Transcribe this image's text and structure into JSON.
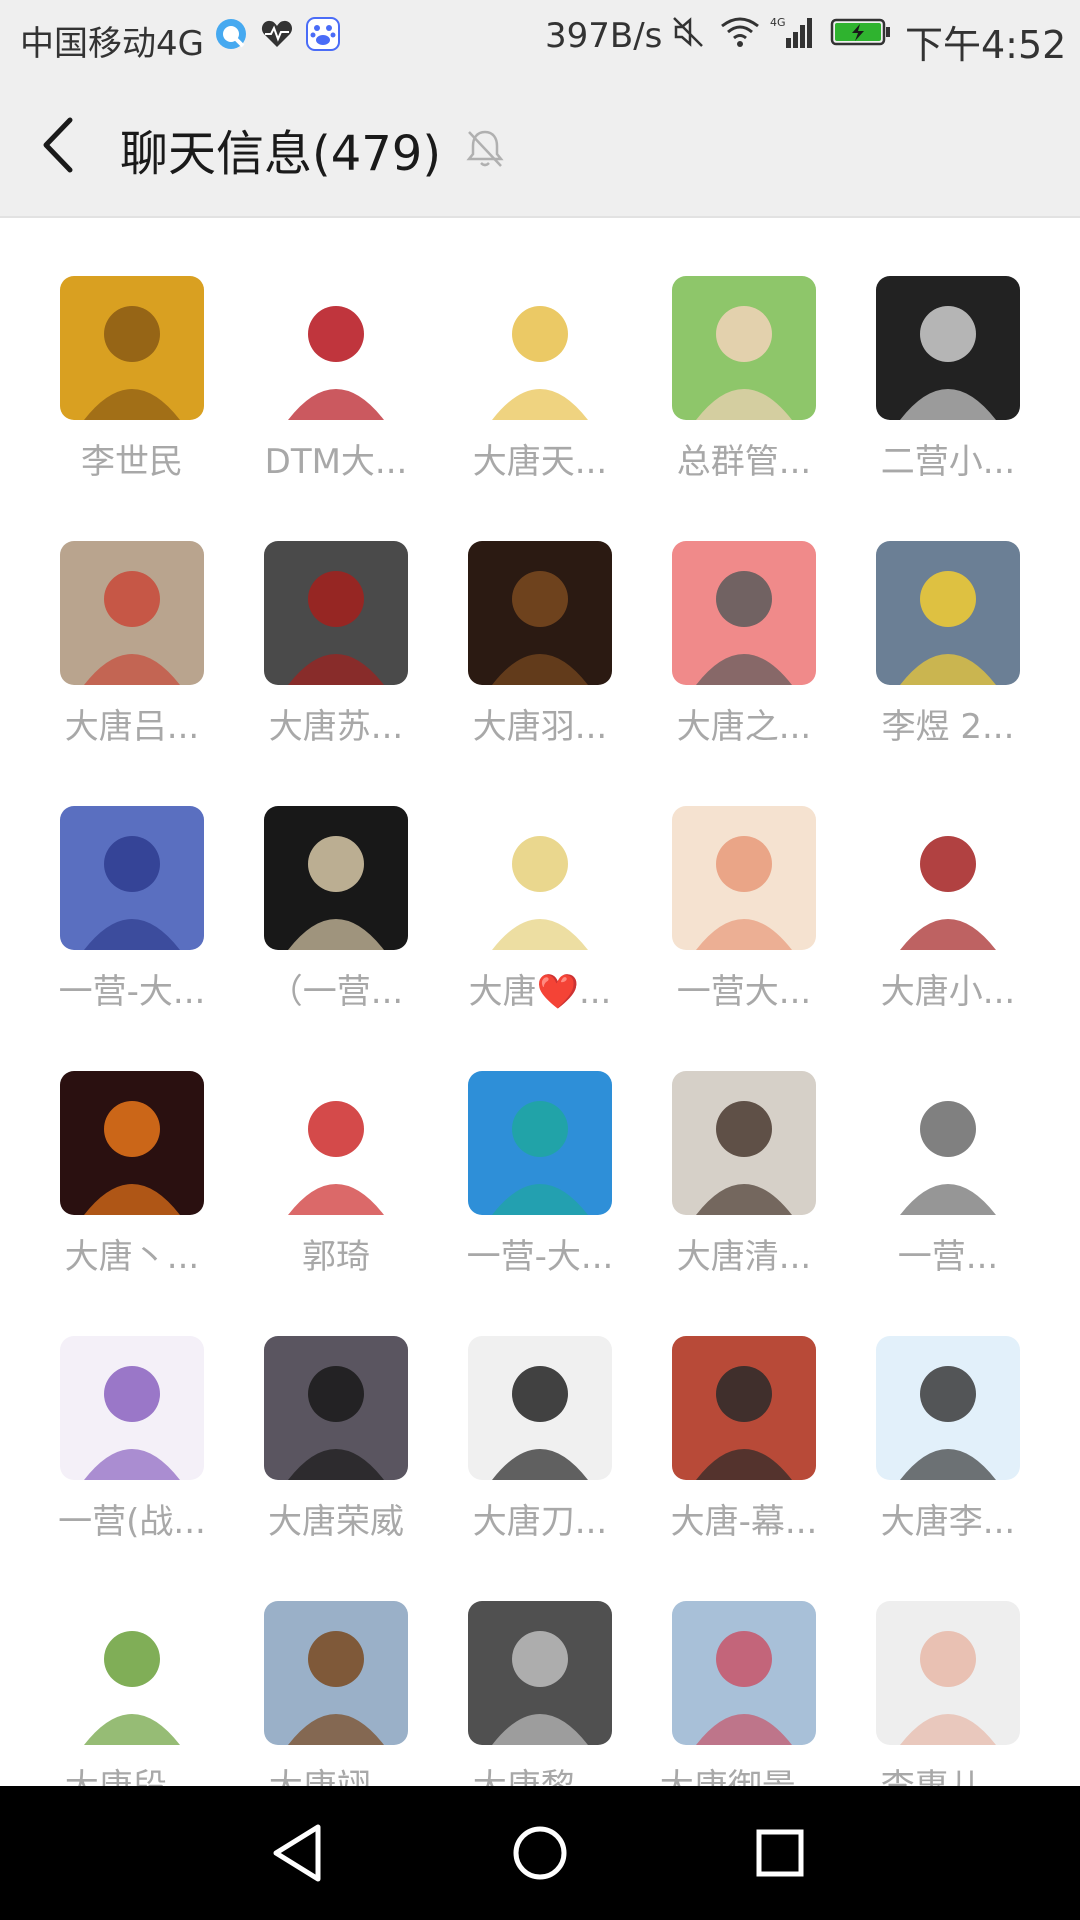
{
  "status_bar": {
    "carrier": "中国移动4G",
    "net_speed": "397B/s",
    "time": "下午4:52",
    "network_badge": "4G",
    "icons_left": [
      "browser-icon",
      "health-heart-icon",
      "baidu-paw-icon"
    ],
    "icons_right": [
      "mute-icon",
      "wifi-icon",
      "signal-icon",
      "battery-charging-icon"
    ],
    "battery_color": "#2fb32f"
  },
  "header": {
    "title": "聊天信息(479)",
    "back_icon": "chevron-left-icon",
    "mute_icon": "bell-off-icon"
  },
  "members": [
    {
      "name": "李世民"
    },
    {
      "name": "DTM大..."
    },
    {
      "name": "大唐天..."
    },
    {
      "name": "总群管..."
    },
    {
      "name": "二营小..."
    },
    {
      "name": "大唐吕..."
    },
    {
      "name": "大唐苏..."
    },
    {
      "name": "大唐羽..."
    },
    {
      "name": "大唐之..."
    },
    {
      "name": "李煜 2..."
    },
    {
      "name": "一营-大..."
    },
    {
      "name": "（一营..."
    },
    {
      "name": "大唐❤️..."
    },
    {
      "name": "一营大..."
    },
    {
      "name": "大唐小..."
    },
    {
      "name": "大唐丶..."
    },
    {
      "name": "郭琦"
    },
    {
      "name": "一营-大..."
    },
    {
      "name": "大唐清..."
    },
    {
      "name": "一营..."
    },
    {
      "name": "一营(战..."
    },
    {
      "name": "大唐荣威"
    },
    {
      "name": "大唐刀..."
    },
    {
      "name": "大唐-幕..."
    },
    {
      "name": "大唐李..."
    },
    {
      "name": "大唐段..."
    },
    {
      "name": "大唐翊..."
    },
    {
      "name": "大唐黎..."
    },
    {
      "name": "大唐御景..."
    },
    {
      "name": "李惠儿..."
    }
  ],
  "nav_bar": {
    "buttons": [
      "back-triangle-icon",
      "home-circle-icon",
      "recents-square-icon"
    ]
  }
}
